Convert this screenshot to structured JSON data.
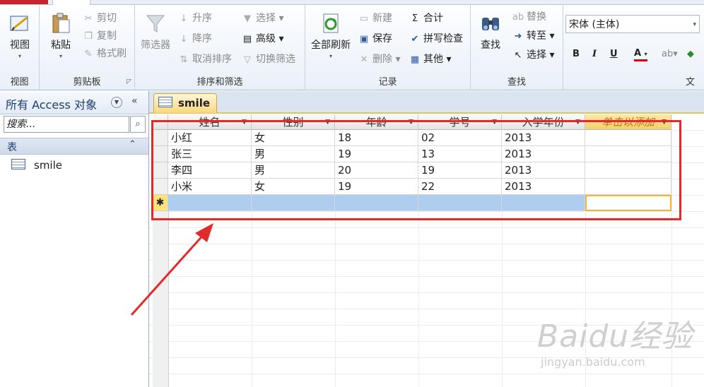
{
  "ribbon": {
    "groups": {
      "view": "视图",
      "clipboard": "剪贴板",
      "sort_filter": "排序和筛选",
      "records": "记录",
      "find": "查找",
      "text_partial": "文"
    },
    "view_label": "视图",
    "paste_label": "粘贴",
    "cut_label": "剪切",
    "copy_label": "复制",
    "format_painter_label": "格式刷",
    "filter_label": "筛选器",
    "ascending_label": "升序",
    "descending_label": "降序",
    "remove_sort_label": "取消排序",
    "selection_label": "选择",
    "advanced_label": "高级",
    "toggle_filter_label": "切换筛选",
    "refresh_all_label": "全部刷新",
    "new_label": "新建",
    "save_label": "保存",
    "delete_label": "删除",
    "totals_label": "合计",
    "spelling_label": "拼写检查",
    "more_label": "其他",
    "find_label": "查找",
    "replace_label": "替换",
    "goto_label": "转至",
    "select_label": "选择",
    "font_name": "宋体 (主体)",
    "bold": "B",
    "italic": "I",
    "underline": "U",
    "font_color": "A"
  },
  "nav": {
    "title": "所有 Access 对象",
    "search_placeholder": "搜索...",
    "category": "表",
    "items": [
      {
        "label": "smile"
      }
    ]
  },
  "document": {
    "tab_label": "smile",
    "columns": [
      "姓名",
      "性别",
      "年龄",
      "学号",
      "入学年份",
      "单击以添加"
    ],
    "rows": [
      [
        "小红",
        "女",
        "18",
        "02",
        "2013"
      ],
      [
        "张三",
        "男",
        "19",
        "13",
        "2013"
      ],
      [
        "李四",
        "男",
        "20",
        "19",
        "2013"
      ],
      [
        "小米",
        "女",
        "19",
        "22",
        "2013"
      ]
    ],
    "new_row_marker": "✱"
  },
  "watermark": {
    "brand": "Baidu经验",
    "url": "jingyan.baidu.com"
  },
  "colors": {
    "annotation": "#e32a2a",
    "new_row": "#aecdef",
    "add_column": "#f6cf6a"
  }
}
